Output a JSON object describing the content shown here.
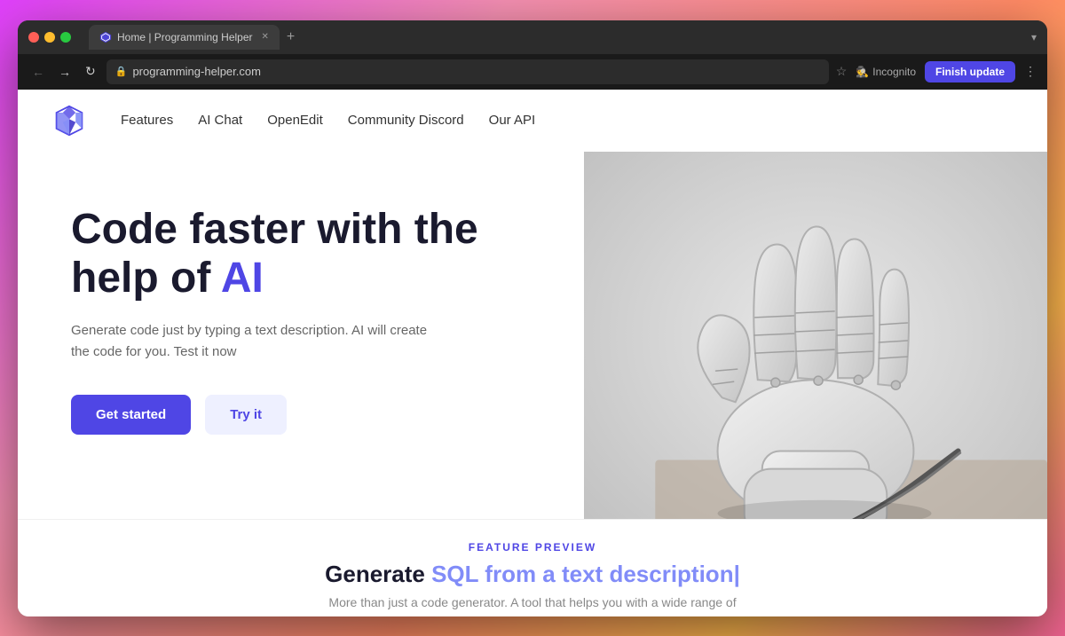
{
  "browser": {
    "tab_title": "Home | Programming Helper",
    "tab_new_label": "+",
    "chevron_label": "▾",
    "nav_back": "←",
    "nav_forward": "→",
    "nav_refresh": "↻",
    "url": "programming-helper.com",
    "star_icon": "☆",
    "incognito_icon": "🕵",
    "incognito_label": "Incognito",
    "finish_update_label": "Finish update",
    "more_icon": "⋮"
  },
  "nav": {
    "links": [
      {
        "label": "Features",
        "id": "features"
      },
      {
        "label": "AI Chat",
        "id": "ai-chat"
      },
      {
        "label": "OpenEdit",
        "id": "openedit"
      },
      {
        "label": "Community Discord",
        "id": "community-discord"
      },
      {
        "label": "Our API",
        "id": "our-api"
      }
    ]
  },
  "hero": {
    "title_part1": "Code faster with the",
    "title_part2": "help of ",
    "title_ai": "AI",
    "description": "Generate code just by typing a text description. AI will create the code for you. Test it now",
    "btn_get_started": "Get started",
    "btn_try_it": "Try it"
  },
  "feature": {
    "label": "FEATURE PREVIEW",
    "title_start": "Generate ",
    "title_highlight": "SQL from a text description",
    "title_cursor": "|",
    "subtitle": "More than just a code generator. A tool that helps you with a wide range of"
  }
}
